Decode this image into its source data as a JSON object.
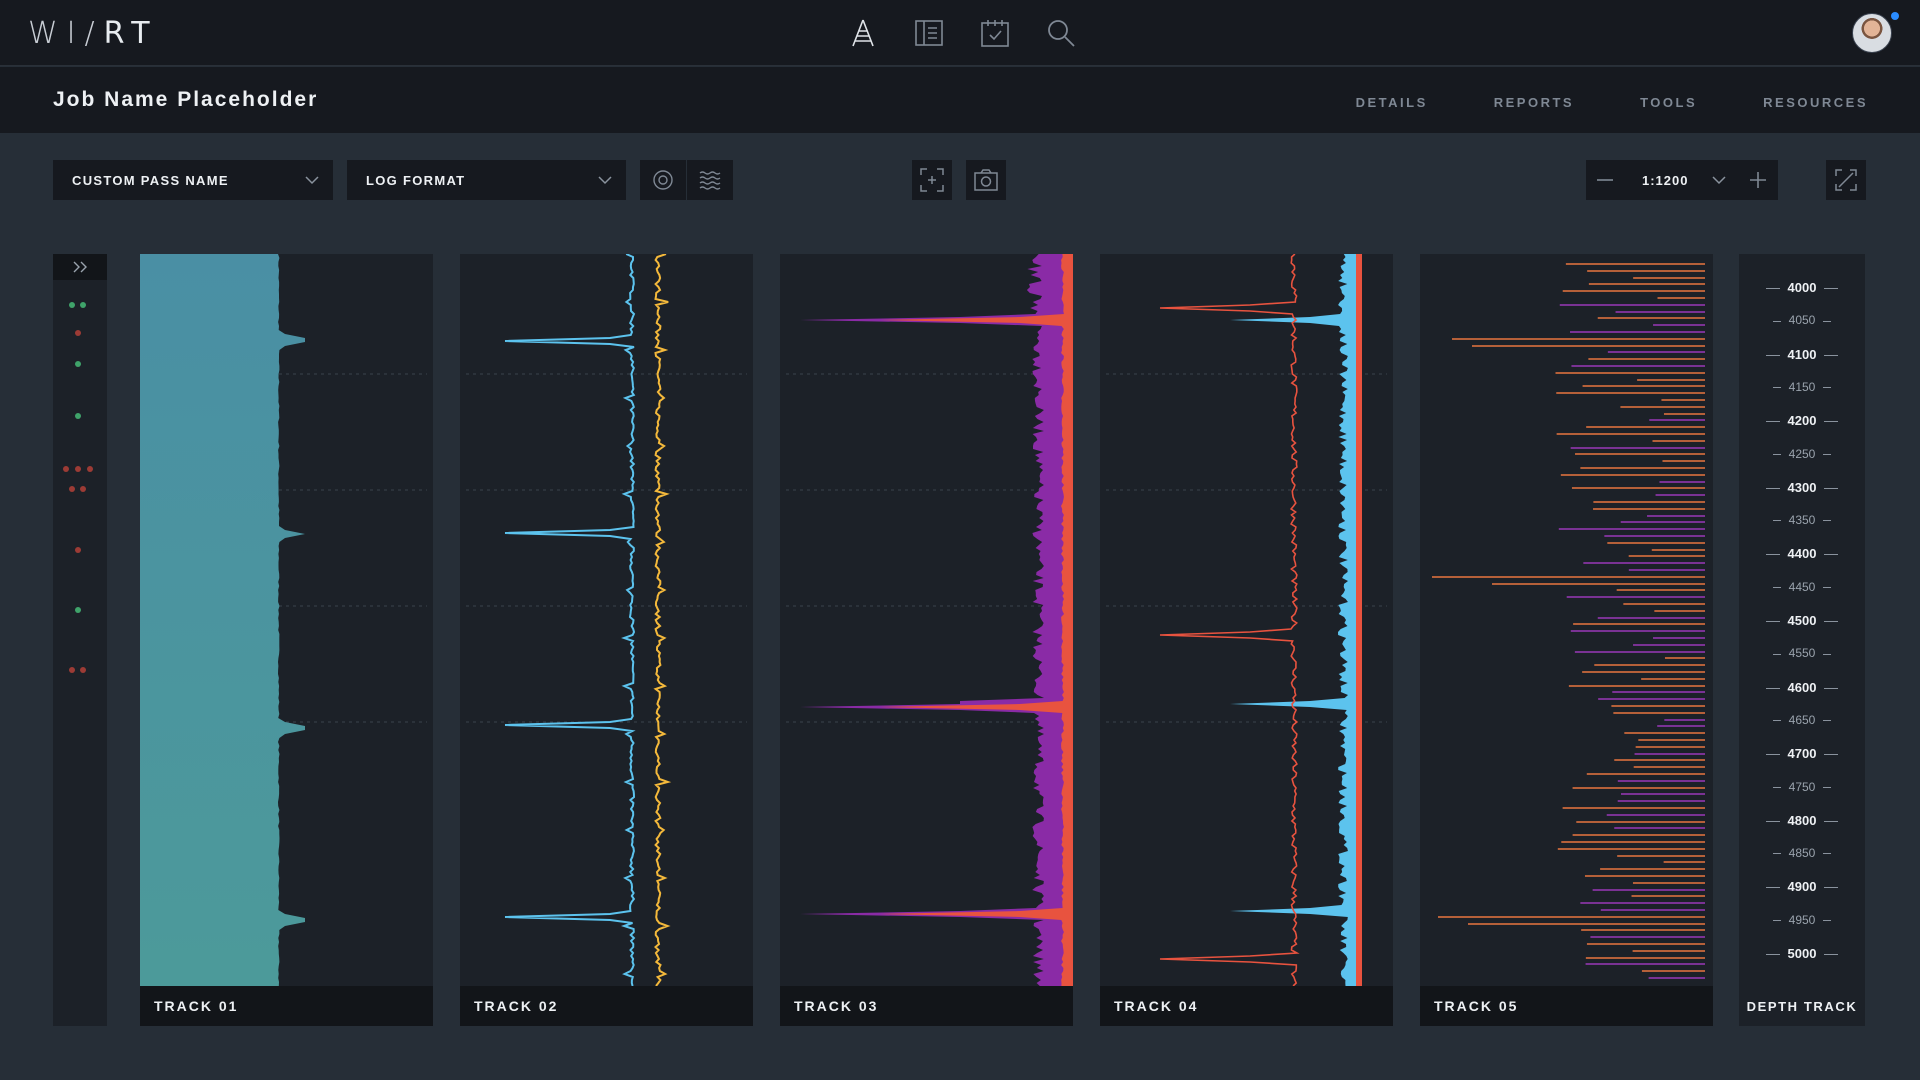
{
  "app": {
    "logo_left": "WI/",
    "logo_right": "RT",
    "nav_icons": [
      "rig-tower-icon",
      "document-icon",
      "checklist-icon",
      "search-icon"
    ],
    "notification_color": "#2a8cff"
  },
  "job": {
    "title": "Job Name Placeholder",
    "nav": [
      "DETAILS",
      "REPORTS",
      "TOOLS",
      "RESOURCES"
    ]
  },
  "toolbar": {
    "pass_select": "CUSTOM PASS NAME",
    "format_select": "LOG FORMAT",
    "view_buttons": [
      "target-icon",
      "waves-icon"
    ],
    "capture_buttons": [
      "focus-frame-icon",
      "camera-icon"
    ],
    "zoom_value": "1:1200",
    "zoom_buttons": [
      "zoom-out-icon",
      "zoom-in-icon",
      "fullscreen-icon"
    ]
  },
  "tracks": [
    {
      "label": "TRACK  01",
      "color": "#4f8fa0"
    },
    {
      "label": "TRACK  02",
      "color": "#5cc3ee"
    },
    {
      "label": "TRACK  03",
      "color": "#e8533f"
    },
    {
      "label": "TRACK  04",
      "color": "#e8533f"
    },
    {
      "label": "TRACK  05",
      "color": "#e8763f"
    }
  ],
  "depth": {
    "label": "DEPTH TRACK",
    "ticks": [
      "4000",
      "4050",
      "4100",
      "4150",
      "4200",
      "4250",
      "4300",
      "4350",
      "4400",
      "4450",
      "4500",
      "4550",
      "4600",
      "4650",
      "4700",
      "4750",
      "4800",
      "4850",
      "4900",
      "4950",
      "5000"
    ]
  },
  "colors": {
    "cyan": "#5cc3ee",
    "yellow": "#f4b93b",
    "red": "#e8533f",
    "purple": "#8a2ba6",
    "green": "#3fa36a",
    "dark_red": "#9c3b35"
  }
}
